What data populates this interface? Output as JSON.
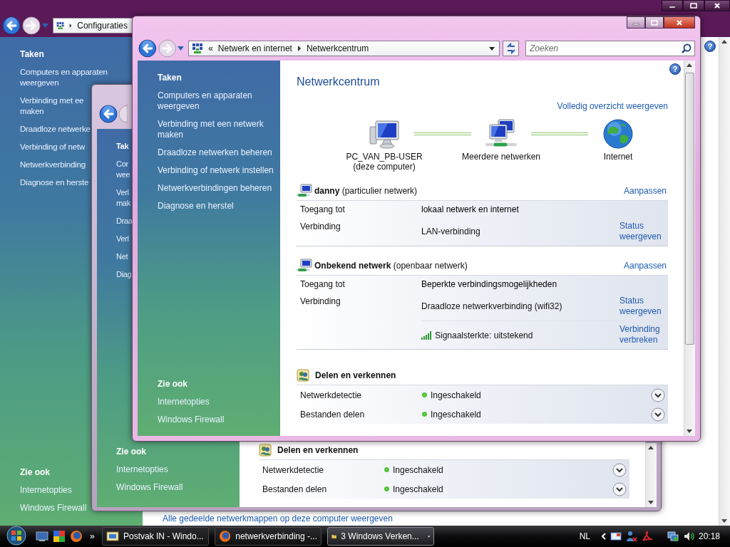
{
  "back_window": {
    "address_crumb": "Configuraties",
    "help": "?",
    "sidebar": {
      "title": "Taken",
      "items": [
        {
          "lines": [
            "Computers en apparaten",
            "weergeven"
          ]
        },
        {
          "lines": [
            "Verbinding met ee",
            "maken"
          ]
        },
        {
          "lines": [
            "Draadloze netwerke"
          ]
        },
        {
          "lines": [
            "Verbinding of netw"
          ]
        },
        {
          "lines": [
            "Netwerkverbinding"
          ]
        },
        {
          "lines": [
            "Diagnose en herste"
          ]
        }
      ],
      "see_also_title": "Zie ook",
      "see_also": [
        "Internetopties",
        "Windows Firewall"
      ]
    },
    "footer_link": "Alle gedeelde netwerkmappen op deze computer weergeven"
  },
  "middle_window": {
    "sidebar": {
      "title": "Tak",
      "items": [
        {
          "lines": [
            "Cor",
            "wee"
          ]
        },
        {
          "lines": [
            "Verl",
            "mak"
          ]
        },
        {
          "lines": [
            "Draa"
          ]
        },
        {
          "lines": [
            "Verl"
          ]
        },
        {
          "lines": [
            "Net"
          ]
        },
        {
          "lines": [
            "Diag"
          ]
        }
      ],
      "see_also_title": "Zie ook",
      "see_also": [
        "Internetopties",
        "Windows Firewall"
      ]
    },
    "sharing": {
      "title": "Delen en verkennen",
      "rows": [
        {
          "label": "Netwerkdetectie",
          "value": "Ingeschakeld",
          "on": true
        },
        {
          "label": "Bestanden delen",
          "value": "Ingeschakeld",
          "on": true
        }
      ]
    }
  },
  "front_window": {
    "address": {
      "overflow_mark": "«",
      "crumbs": [
        "Netwerk en internet",
        "Netwerkcentrum"
      ]
    },
    "search": {
      "placeholder": "Zoeken"
    },
    "help": "?",
    "sidebar": {
      "title": "Taken",
      "items": [
        {
          "lines": [
            "Computers en apparaten",
            "weergeven"
          ]
        },
        {
          "lines": [
            "Verbinding met een netwerk",
            "maken"
          ]
        },
        {
          "lines": [
            "Draadloze netwerken beheren"
          ]
        },
        {
          "lines": [
            "Verbinding of netwerk instellen"
          ]
        },
        {
          "lines": [
            "Netwerkverbindingen beheren"
          ]
        },
        {
          "lines": [
            "Diagnose en herstel"
          ]
        }
      ],
      "see_also_title": "Zie ook",
      "see_also": [
        "Internetopties",
        "Windows Firewall"
      ]
    },
    "title": "Netwerkcentrum",
    "full_map_link": "Volledig overzicht weergeven",
    "map_nodes": [
      {
        "kind": "computer",
        "label": "PC_VAN_PB-USER",
        "sublabel": "(deze computer)"
      },
      {
        "kind": "network",
        "label": "Meerdere netwerken"
      },
      {
        "kind": "internet",
        "label": "Internet"
      }
    ],
    "networks": [
      {
        "name": "danny",
        "type": "(particulier netwerk)",
        "action": "Aanpassen",
        "access_label": "Toegang tot",
        "access": "lokaal netwerk en internet",
        "connection_label": "Verbinding",
        "connections": [
          {
            "kind": "connection",
            "value": "LAN-verbinding",
            "action": "Status weergeven"
          }
        ]
      },
      {
        "name": "Onbekend netwerk",
        "type": "(openbaar netwerk)",
        "action": "Aanpassen",
        "access_label": "Toegang tot",
        "access": "Beperkte verbindingsmogelijkheden",
        "connection_label": "Verbinding",
        "connections": [
          {
            "kind": "connection",
            "value": "Draadloze netwerkverbinding (wifi32)",
            "action": "Status weergeven"
          },
          {
            "kind": "signal",
            "value": "Signaalsterkte: uitstekend",
            "action": "Verbinding verbreken"
          }
        ]
      }
    ],
    "sharing": {
      "title": "Delen en verkennen",
      "rows": [
        {
          "label": "Netwerkdetectie",
          "value": "Ingeschakeld",
          "on": true
        },
        {
          "label": "Bestanden delen",
          "value": "Ingeschakeld",
          "on": true
        }
      ]
    }
  },
  "taskbar": {
    "overflow": "»",
    "buttons": [
      {
        "kind": "mail",
        "label": "Postvak IN - Windo...",
        "selected": false,
        "grouped": false
      },
      {
        "kind": "browser",
        "label": "netwerkverbinding -...",
        "selected": false,
        "grouped": false
      },
      {
        "kind": "folder",
        "label": "3 Windows Verken...",
        "selected": true,
        "grouped": true
      }
    ],
    "language": "NL",
    "clock": "20:18"
  }
}
